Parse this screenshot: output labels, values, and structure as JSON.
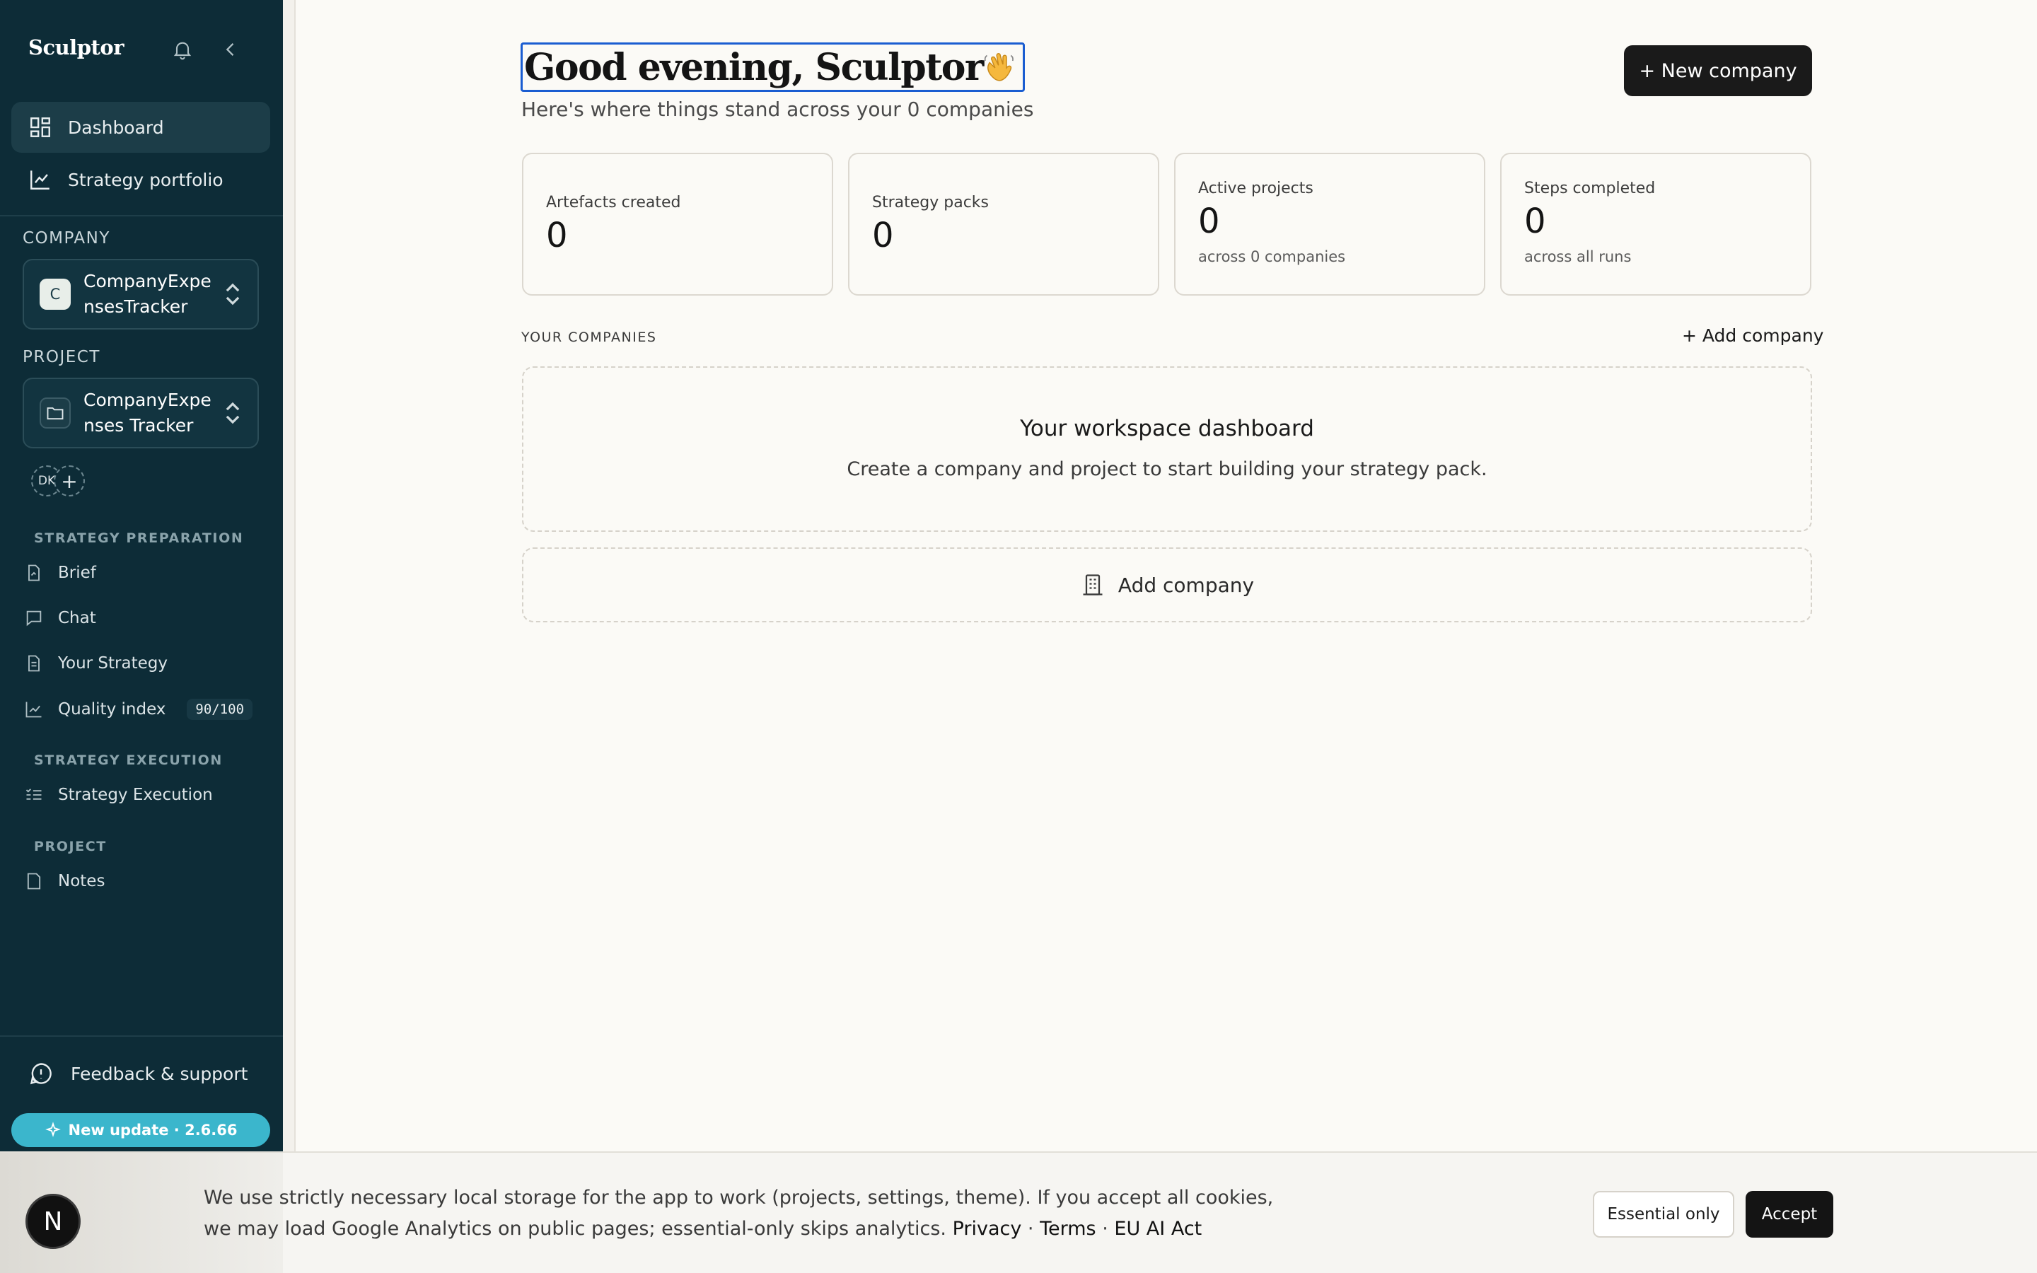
{
  "sidebar": {
    "brand": "Sculptor",
    "nav": [
      {
        "label": "Dashboard",
        "icon": "dashboard-grid-icon"
      },
      {
        "label": "Strategy portfolio",
        "icon": "chart-line-icon"
      }
    ],
    "company_label": "COMPANY",
    "company": {
      "initial": "C",
      "name": "CompanyExpensesTracker"
    },
    "project_label": "PROJECT",
    "project": {
      "name": "CompanyExpenses Tracker"
    },
    "avatar_initials": "DK",
    "avatar_add": "+",
    "prep_label": "STRATEGY PREPARATION",
    "prep_items": [
      {
        "label": "Brief",
        "icon": "brief-doc-icon"
      },
      {
        "label": "Chat",
        "icon": "chat-bubble-icon"
      },
      {
        "label": "Your Strategy",
        "icon": "document-icon"
      },
      {
        "label": "Quality index",
        "icon": "chart-icon",
        "score": "90/100"
      }
    ],
    "exec_label": "STRATEGY EXECUTION",
    "exec_items": [
      {
        "label": "Strategy Execution",
        "icon": "checklist-icon"
      }
    ],
    "project_section_label": "PROJECT",
    "project_items": [
      {
        "label": "Notes",
        "icon": "note-icon"
      }
    ],
    "feedback": "Feedback & support",
    "update": "New update · 2.6.66"
  },
  "main": {
    "greeting": "Good evening, Sculptor",
    "subtitle": "Here's where things stand across your 0 companies",
    "new_company": "+ New company",
    "stats": [
      {
        "label": "Artefacts created",
        "value": "0",
        "note": ""
      },
      {
        "label": "Strategy packs",
        "value": "0",
        "note": ""
      },
      {
        "label": "Active projects",
        "value": "0",
        "note": "across 0 companies"
      },
      {
        "label": "Steps completed",
        "value": "0",
        "note": "across all runs"
      }
    ],
    "companies_label": "YOUR COMPANIES",
    "add_company_link": "+ Add company",
    "empty_title": "Your workspace dashboard",
    "empty_body": "Create a company and project to start building your strategy pack.",
    "add_company_card": "Add company"
  },
  "cookie": {
    "badge": "N",
    "text": "We use strictly necessary local storage for the app to work (projects, settings, theme). If you accept all cookies, we may load Google Analytics on public pages; essential-only skips analytics.",
    "privacy": "Privacy",
    "terms": "Terms",
    "sep": "·",
    "euai": "EU AI Act",
    "essential": "Essential only",
    "accept": "Accept"
  },
  "colors": {
    "sidebar_bg": "#0d2c37",
    "accent_update": "#3bb6cc",
    "focus_ring": "#1a5dd1",
    "page_bg": "#fbfaf6"
  }
}
